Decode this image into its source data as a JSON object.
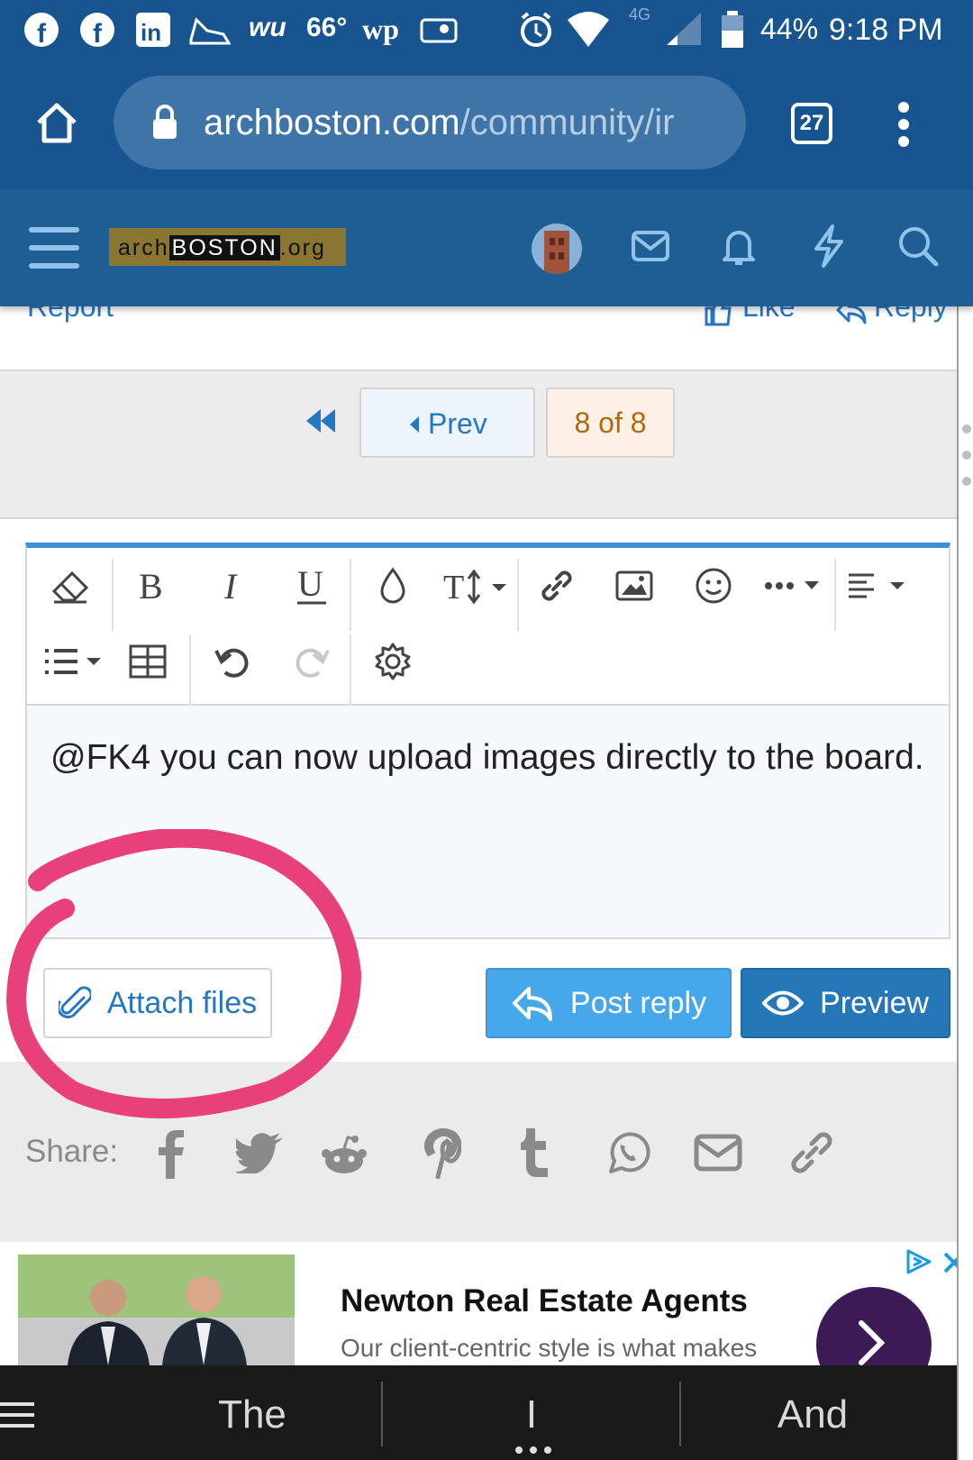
{
  "status_bar": {
    "temperature": "66°",
    "battery": "44%",
    "time": "9:18 PM",
    "network": "4G",
    "weather_app": "wu",
    "news_app": "wp"
  },
  "browser": {
    "url_host": "archboston.com",
    "url_path": "/community/ir",
    "tab_count": "27"
  },
  "site": {
    "logo_prefix": "arch",
    "logo_main": "BOSTON",
    "logo_suffix": ".org"
  },
  "post_actions": {
    "report": "Report",
    "like": "Like",
    "reply": "Reply"
  },
  "pagination": {
    "prev_label": "Prev",
    "current": "8 of 8"
  },
  "editor": {
    "body_text": "@FK4 you can now upload images directly to the board."
  },
  "buttons": {
    "attach": "Attach files",
    "post_reply": "Post reply",
    "preview": "Preview"
  },
  "share": {
    "label": "Share:"
  },
  "ad": {
    "title": "Newton Real Estate Agents",
    "subtitle": "Our client-centric style is what makes"
  },
  "keyboard_suggestions": [
    "The",
    "I",
    "And"
  ],
  "colors": {
    "header": "#1e5e93",
    "browser": "#185490",
    "accent": "#2577c4",
    "annotation": "#e8407a"
  }
}
